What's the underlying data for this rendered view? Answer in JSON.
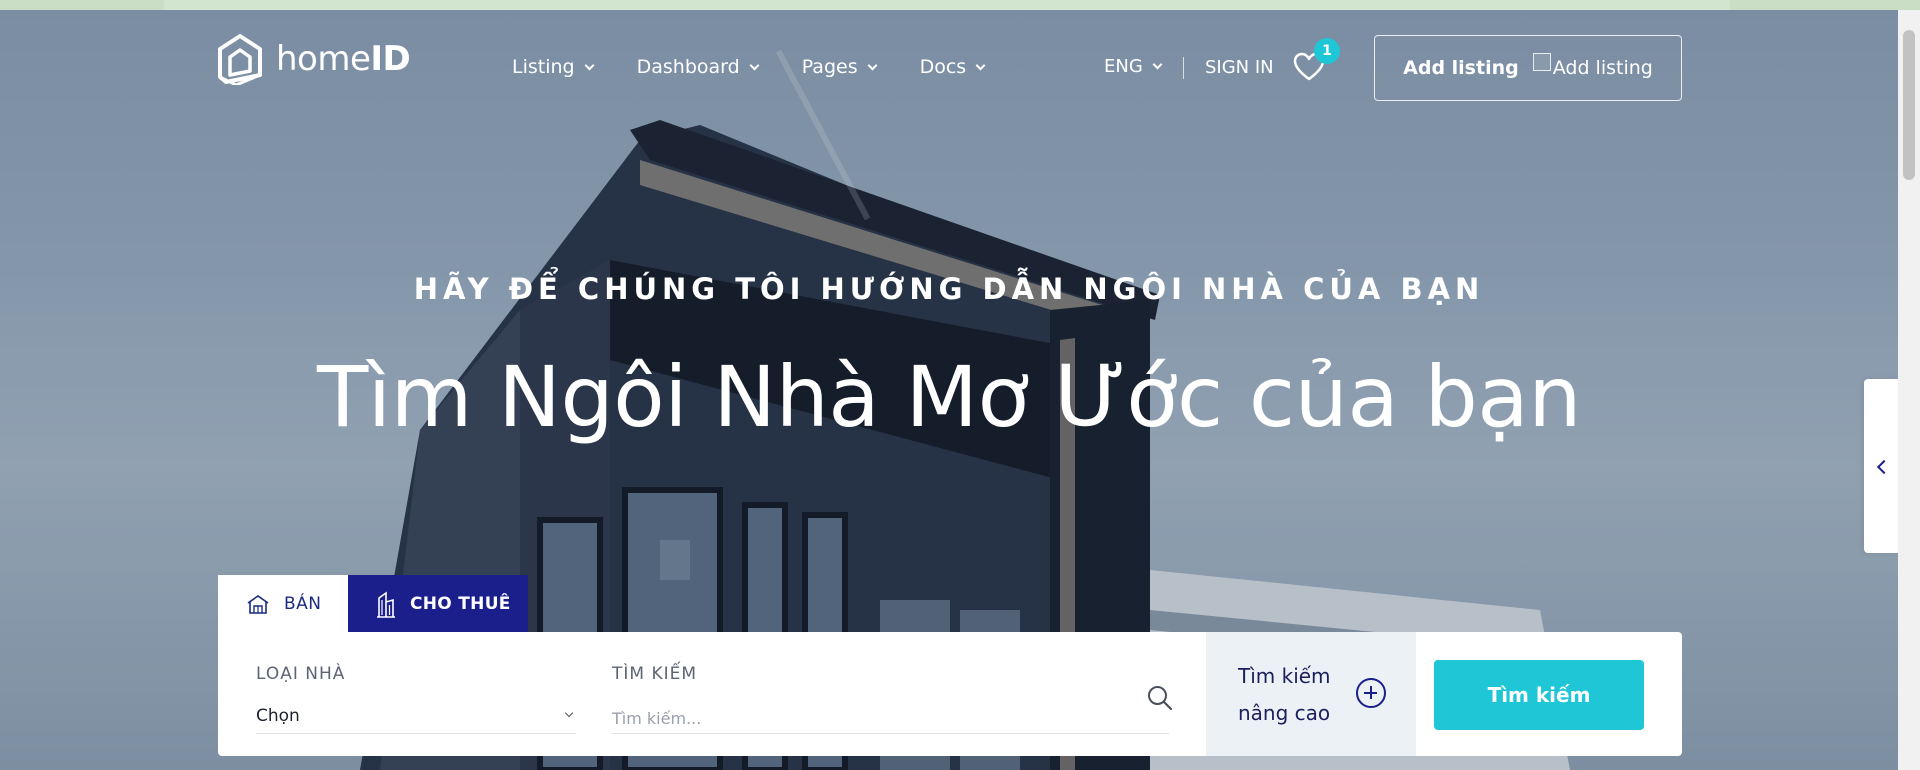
{
  "header": {
    "logo_text_light": "home",
    "logo_text_bold": "ID",
    "nav": [
      {
        "label": "Listing"
      },
      {
        "label": "Dashboard"
      },
      {
        "label": "Pages"
      },
      {
        "label": "Docs"
      }
    ],
    "language": "ENG",
    "sign_in": "SIGN IN",
    "wishlist_count": "1",
    "add_listing_label": "Add listing",
    "add_listing_img_alt": "Add listing"
  },
  "hero": {
    "eyebrow": "HÃY ĐỂ CHÚNG TÔI HƯỚNG DẪN NGÔI NHÀ CỦA BẠN",
    "headline": "Tìm Ngôi Nhà Mơ Ước của bạn"
  },
  "search": {
    "tabs": [
      {
        "label": "BÁN",
        "active": true
      },
      {
        "label": "CHO THUÊ",
        "active": false
      }
    ],
    "type_label": "LOẠI NHÀ",
    "type_value": "Chọn",
    "keyword_label": "TÌM KIẾM",
    "keyword_placeholder": "Tìm kiếm...",
    "advanced_line1": "Tìm kiếm",
    "advanced_line2": "nâng cao",
    "submit_label": "Tìm kiếm"
  },
  "colors": {
    "brand_navy": "#1b1f8c",
    "accent_cyan": "#1ec6d6"
  },
  "icons": {
    "logo": "house-logo-icon",
    "wishlist": "heart-icon",
    "sell_tab": "house-icon",
    "rent_tab": "building-icon",
    "search": "search-icon",
    "advanced": "plus-circle-icon",
    "side_toggle": "chevron-left-icon"
  }
}
